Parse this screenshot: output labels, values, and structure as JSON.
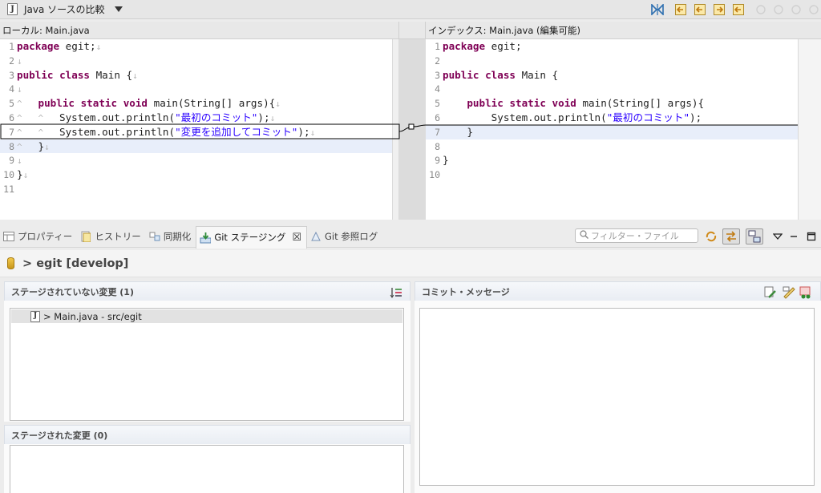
{
  "window": {
    "compare_title": "Java ソースの比較",
    "java_icon_text": "J"
  },
  "compare": {
    "left_header": "ローカル: Main.java",
    "right_header": "インデックス: Main.java (編集可能)",
    "left_lines": [
      {
        "n": "1",
        "tokens": [
          {
            "t": "package",
            "c": "kw"
          },
          {
            "t": " egit;"
          }
        ],
        "ws": true
      },
      {
        "n": "2",
        "tokens": [],
        "ws": true
      },
      {
        "n": "3",
        "tokens": [
          {
            "t": "public",
            "c": "kw"
          },
          {
            "t": " "
          },
          {
            "t": "class",
            "c": "kw"
          },
          {
            "t": " Main {"
          }
        ],
        "ws": true
      },
      {
        "n": "4",
        "tokens": [],
        "ws": true
      },
      {
        "n": "5",
        "tokens": [
          {
            "t": "^   ",
            "c": "ws"
          },
          {
            "t": "public",
            "c": "kw"
          },
          {
            "t": " "
          },
          {
            "t": "static",
            "c": "kw"
          },
          {
            "t": " "
          },
          {
            "t": "void",
            "c": "kw"
          },
          {
            "t": " main(String[] args){"
          }
        ],
        "ws": true
      },
      {
        "n": "6",
        "tokens": [
          {
            "t": "^   ",
            "c": "ws"
          },
          {
            "t": "^   ",
            "c": "ws"
          },
          {
            "t": "System.out.println("
          },
          {
            "t": "\"最初のコミット\"",
            "c": "str"
          },
          {
            "t": ");"
          }
        ],
        "ws": true
      },
      {
        "n": "7",
        "tokens": [
          {
            "t": "^   ",
            "c": "ws"
          },
          {
            "t": "^   ",
            "c": "ws"
          },
          {
            "t": "System.out.println("
          },
          {
            "t": "\"変更を追加してコミット\"",
            "c": "str"
          },
          {
            "t": ");"
          }
        ],
        "ws": true
      },
      {
        "n": "8",
        "tokens": [
          {
            "t": "^   ",
            "c": "ws"
          },
          {
            "t": "}"
          }
        ],
        "ws": true
      },
      {
        "n": "9",
        "tokens": [],
        "ws": true
      },
      {
        "n": "10",
        "tokens": [
          {
            "t": "}"
          }
        ],
        "ws": true
      },
      {
        "n": "11",
        "tokens": [],
        "ws": false
      }
    ],
    "right_lines": [
      {
        "n": "1",
        "tokens": [
          {
            "t": "package",
            "c": "kw"
          },
          {
            "t": " egit;"
          }
        ]
      },
      {
        "n": "2",
        "tokens": []
      },
      {
        "n": "3",
        "tokens": [
          {
            "t": "public",
            "c": "kw"
          },
          {
            "t": " "
          },
          {
            "t": "class",
            "c": "kw"
          },
          {
            "t": " Main {"
          }
        ]
      },
      {
        "n": "4",
        "tokens": []
      },
      {
        "n": "5",
        "tokens": [
          {
            "t": "    "
          },
          {
            "t": "public",
            "c": "kw"
          },
          {
            "t": " "
          },
          {
            "t": "static",
            "c": "kw"
          },
          {
            "t": " "
          },
          {
            "t": "void",
            "c": "kw"
          },
          {
            "t": " main(String[] args){"
          }
        ]
      },
      {
        "n": "6",
        "tokens": [
          {
            "t": "        System.out.println("
          },
          {
            "t": "\"最初のコミット\"",
            "c": "str"
          },
          {
            "t": ");"
          }
        ]
      },
      {
        "n": "7",
        "tokens": [
          {
            "t": "    }"
          }
        ]
      },
      {
        "n": "8",
        "tokens": []
      },
      {
        "n": "9",
        "tokens": [
          {
            "t": "}"
          }
        ]
      },
      {
        "n": "10",
        "tokens": []
      }
    ]
  },
  "views": {
    "tabs": [
      {
        "label": "プロパティー",
        "icon": "properties-icon"
      },
      {
        "label": "ヒストリー",
        "icon": "history-icon"
      },
      {
        "label": "同期化",
        "icon": "synchronize-icon"
      },
      {
        "label": "Git ステージング",
        "icon": "git-staging-icon",
        "active": true
      },
      {
        "label": "Git 参照ログ",
        "icon": "git-reflog-icon"
      }
    ],
    "filter_placeholder": "フィルター・ファイル"
  },
  "staging": {
    "repo_label": "> egit [develop]",
    "unstaged_title": "ステージされていない変更 (1)",
    "unstaged_files": [
      "> Main.java - src/egit"
    ],
    "staged_title": "ステージされた変更 (0)",
    "commit_title": "コミット・メッセージ"
  }
}
